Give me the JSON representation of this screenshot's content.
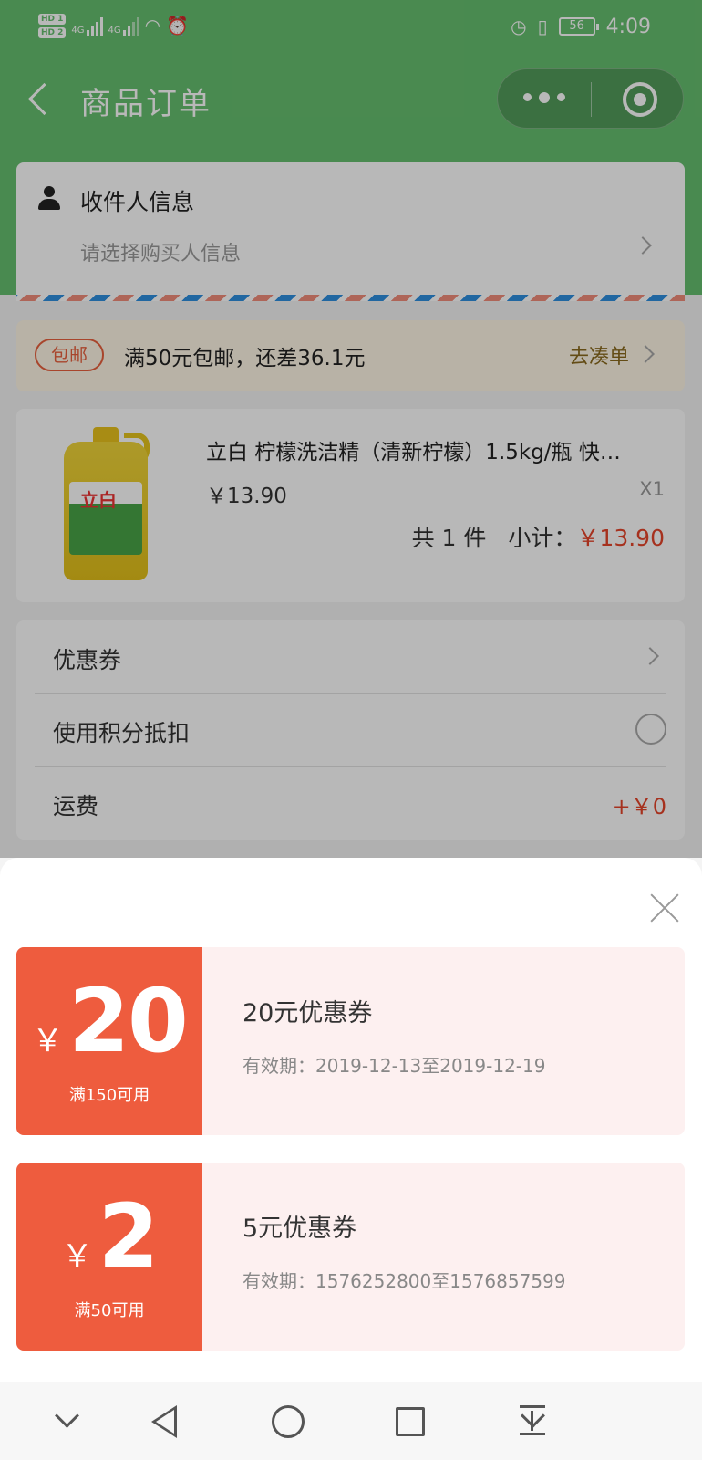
{
  "status_bar": {
    "hd1": "HD 1",
    "hd2": "HD 2",
    "net1": "4G",
    "net2": "4G",
    "battery": "56",
    "time": "4:09"
  },
  "nav": {
    "title": "商品订单"
  },
  "address": {
    "label": "收件人信息",
    "hint": "请选择购买人信息"
  },
  "shipping": {
    "tag": "包邮",
    "text": "满50元包邮，还差36.1元",
    "action": "去凑单"
  },
  "goods": {
    "name": "立白 柠檬洗洁精（清新柠檬）1.5kg/瓶 快…",
    "price": "￥13.90",
    "qty": "X1",
    "count": "共 1 件",
    "subtotal_label": "小计：",
    "subtotal": "￥13.90",
    "brand": "立白"
  },
  "options": {
    "coupon": "优惠券",
    "points": "使用积分抵扣",
    "freight": "运费",
    "freight_value": "+￥0"
  },
  "coupons": [
    {
      "yen": "￥",
      "amount": "20",
      "condition": "满150可用",
      "name": "20元优惠券",
      "validity": "有效期：2019-12-13至2019-12-19"
    },
    {
      "yen": "￥",
      "amount": "2",
      "condition": "满50可用",
      "name": "5元优惠券",
      "validity": "有效期：1576252800至1576857599"
    }
  ],
  "colors": {
    "brand_green": "#66bf6f",
    "coupon_red": "#ee5c3e",
    "price_red": "#e6452a"
  }
}
